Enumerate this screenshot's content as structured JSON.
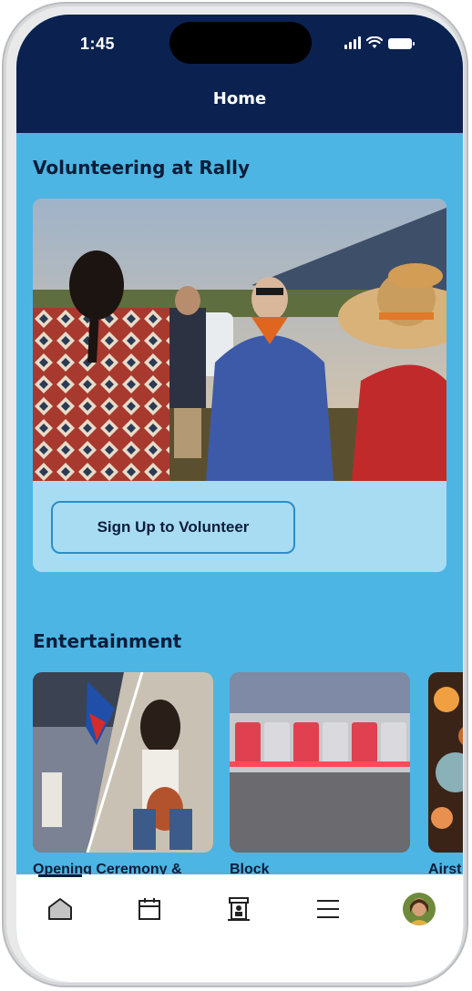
{
  "status_bar": {
    "time": "1:45"
  },
  "header": {
    "title": "Home"
  },
  "volunteer_section": {
    "title": "Volunteering at Rally",
    "signup_label": "Sign Up to Volunteer"
  },
  "entertainment_section": {
    "title": "Entertainment",
    "cards": [
      {
        "label": "Opening Ceremony &"
      },
      {
        "label": "Block"
      },
      {
        "label": "Airst"
      }
    ]
  },
  "tabbar": {
    "items": [
      {
        "icon": "home-icon",
        "selected": true
      },
      {
        "icon": "calendar-icon",
        "selected": false
      },
      {
        "icon": "booth-icon",
        "selected": false
      },
      {
        "icon": "menu-icon",
        "selected": false
      },
      {
        "icon": "profile-avatar",
        "selected": false
      }
    ]
  },
  "colors": {
    "header_bg": "#0b2250",
    "content_bg": "#4db5e3",
    "card_bg": "#a8dcf3",
    "button_border": "#2a8fc6",
    "text_dark": "#0b1d3a"
  }
}
